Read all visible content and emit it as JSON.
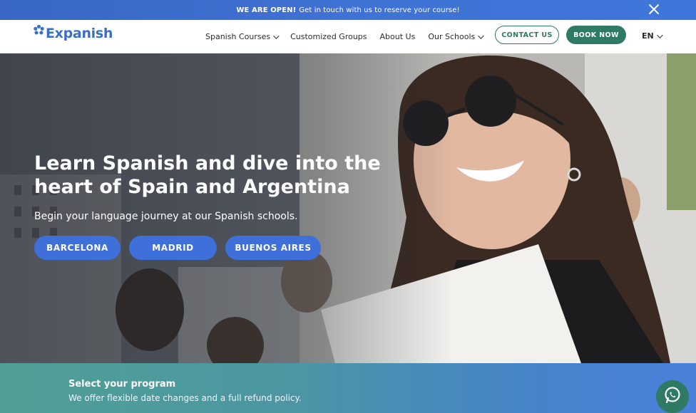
{
  "announcement": {
    "bold": "WE ARE OPEN!",
    "text": "Get in touch with us to reserve your course!",
    "close_icon": "close-icon"
  },
  "brand": {
    "name": "Expanish",
    "logo_icon": "flower-logo-icon"
  },
  "nav": {
    "items": [
      {
        "label": "Spanish Courses",
        "dropdown": true
      },
      {
        "label": "Customized Groups",
        "dropdown": false
      },
      {
        "label": "About Us",
        "dropdown": false
      },
      {
        "label": "Our Schools",
        "dropdown": true
      }
    ],
    "contact_label": "CONTACT US",
    "book_label": "BOOK NOW",
    "language": "EN"
  },
  "hero": {
    "title_line1": "Learn Spanish and dive into the",
    "title_line2": "heart of Spain and Argentina",
    "subtitle": "Begin your language journey at our Spanish schools.",
    "cities": [
      "BARCELONA",
      "MADRID",
      "BUENOS AIRES"
    ]
  },
  "program": {
    "title": "Select your program",
    "subtitle": "We offer flexible date changes and a full refund policy."
  },
  "floating": {
    "whatsapp_icon": "whatsapp-icon"
  },
  "colors": {
    "accent_blue": "#3f6fd8",
    "brand_green": "#2e7a62",
    "logo_blue": "#3a6fc4",
    "announce_blue": "#3f73d6"
  }
}
